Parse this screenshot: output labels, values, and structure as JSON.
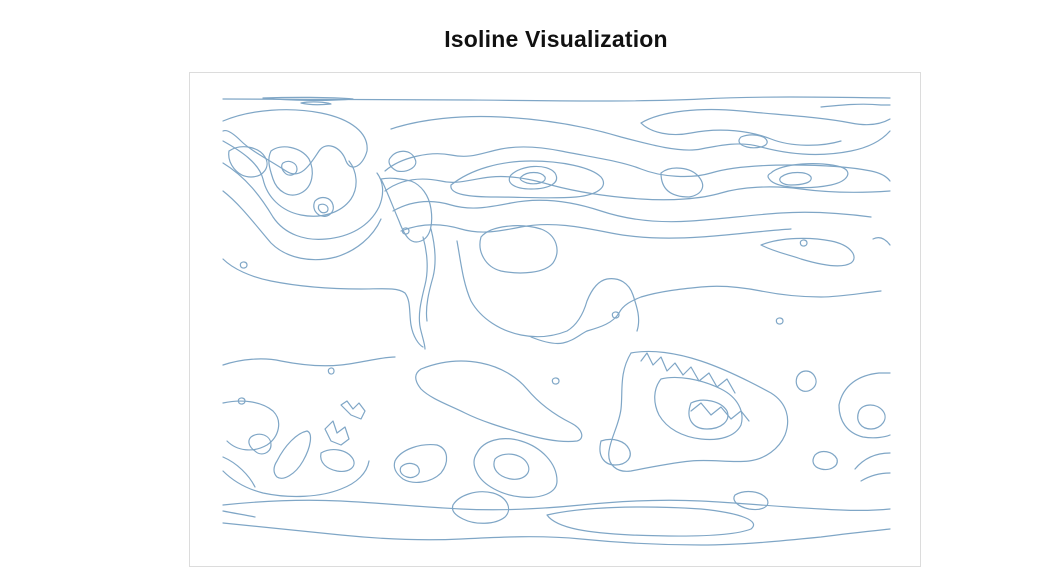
{
  "title": "Isoline Visualization",
  "colors": {
    "isoline": "#7fa6c6",
    "frame": "#dcdcdc",
    "title": "#111111"
  },
  "map": {
    "type": "contour-map",
    "projection": "equirectangular",
    "content": "world-landmass-isolines"
  }
}
